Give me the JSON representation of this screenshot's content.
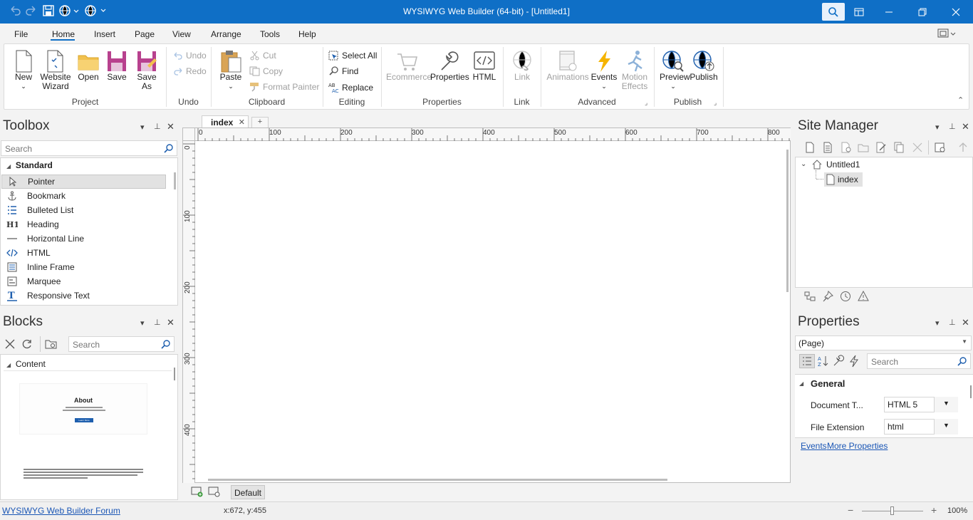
{
  "titlebar": {
    "title": "WYSIWYG Web Builder (64-bit) - [Untitled1]"
  },
  "menu": {
    "items": [
      "File",
      "Home",
      "Insert",
      "Page",
      "View",
      "Arrange",
      "Tools",
      "Help"
    ],
    "active": "Home"
  },
  "ribbon": {
    "project": {
      "label": "Project",
      "new": "New",
      "website_wizard_1": "Website",
      "website_wizard_2": "Wizard",
      "open": "Open",
      "save": "Save",
      "save_as_1": "Save",
      "save_as_2": "As"
    },
    "undo": {
      "label": "Undo",
      "undo": "Undo",
      "redo": "Redo"
    },
    "clipboard": {
      "label": "Clipboard",
      "paste": "Paste",
      "cut": "Cut",
      "copy": "Copy",
      "format_painter": "Format Painter"
    },
    "editing": {
      "label": "Editing",
      "select_all": "Select All",
      "find": "Find",
      "replace": "Replace"
    },
    "properties": {
      "label": "Properties",
      "ecommerce": "Ecommerce",
      "properties": "Properties",
      "html": "HTML"
    },
    "link": {
      "label": "Link",
      "link": "Link"
    },
    "advanced": {
      "label": "Advanced",
      "animations": "Animations",
      "events": "Events",
      "motion_1": "Motion",
      "motion_2": "Effects"
    },
    "publish": {
      "label": "Publish",
      "preview": "Preview",
      "publish": "Publish"
    }
  },
  "toolbox": {
    "title": "Toolbox",
    "search_placeholder": "Search",
    "category": "Standard",
    "items": [
      "Pointer",
      "Bookmark",
      "Bulleted List",
      "Heading",
      "Horizontal Line",
      "HTML",
      "Inline Frame",
      "Marquee",
      "Responsive Text"
    ]
  },
  "blocks": {
    "title": "Blocks",
    "search_placeholder": "Search",
    "category": "Content",
    "preview_heading": "About",
    "preview_button": "Learn More"
  },
  "canvas": {
    "tab": "index",
    "add_tab": "+",
    "ruler_top": [
      "0",
      "100",
      "200",
      "300",
      "400",
      "500",
      "600",
      "700",
      "800"
    ],
    "ruler_left": [
      "0",
      "100",
      "200",
      "300",
      "400"
    ],
    "breakpoint": "Default"
  },
  "site_manager": {
    "title": "Site Manager",
    "root": "Untitled1",
    "page": "index"
  },
  "properties": {
    "title": "Properties",
    "selector": "(Page)",
    "search_placeholder": "Search",
    "section": "General",
    "rows": [
      {
        "name": "Document T...",
        "value": "HTML 5"
      },
      {
        "name": "File Extension",
        "value": "html"
      }
    ],
    "link_events": "Events",
    "link_more": "More Properties"
  },
  "status": {
    "forum_link": "WYSIWYG Web Builder Forum",
    "coords": "x:672, y:455",
    "zoom": "100%",
    "zoom_minus": "−",
    "zoom_plus": "+"
  },
  "colors": {
    "titlebar": "#0f6fc6",
    "accent": "#1e5fae",
    "events_icon": "#f5b400"
  }
}
